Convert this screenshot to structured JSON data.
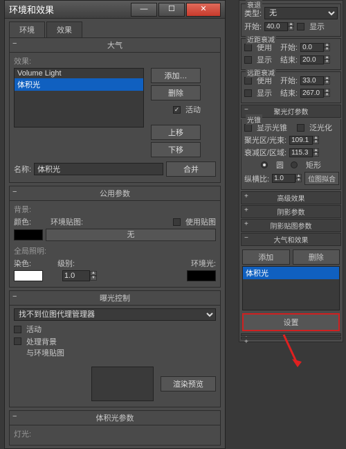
{
  "dialog": {
    "title": "环境和效果",
    "tabs": {
      "env": "环境",
      "fx": "效果"
    },
    "atmosphere": {
      "header": "大气",
      "list": [
        "Volume Light",
        "体积光"
      ],
      "selected_index": 1,
      "buttons": {
        "add": "添加…",
        "del": "删除",
        "up": "上移",
        "down": "下移",
        "merge": "合并"
      },
      "active_cb": "活动",
      "name_label": "名称:",
      "name_value": "体积光"
    },
    "common": {
      "header": "公用参数",
      "bg_label": "背景:",
      "color_label": "颜色:",
      "envmap_label": "环境贴图:",
      "usemap_label": "使用贴图",
      "map_none": "无",
      "global_label": "全局照明:",
      "tint_label": "染色:",
      "level_label": "级别:",
      "level_value": "1.0",
      "amb_label": "环境光:"
    },
    "exposure": {
      "header": "曝光控制",
      "select": "找不到位图代理管理器",
      "active": "活动",
      "process": "处理背景\n与环境贴图",
      "preview": "渲染预览"
    },
    "volume": {
      "header": "体积光参数",
      "lights": "灯光:"
    }
  },
  "right": {
    "decay": "衰退",
    "type_label": "类型:",
    "type_value": "无",
    "start_label": "开始:",
    "start_value": "40.0",
    "show_label": "显示",
    "near": {
      "title": "近距衰减",
      "use": "使用",
      "start": "开始:",
      "start_v": "0.0",
      "show": "显示",
      "end": "结束:",
      "end_v": "20.0"
    },
    "far": {
      "title": "远距衰减",
      "use": "使用",
      "start": "开始:",
      "start_v": "33.0",
      "show": "显示",
      "end": "结束:",
      "end_v": "267.0"
    },
    "spot": {
      "header": "聚光灯参数",
      "cone": "光锥",
      "showcone": "显示光锥",
      "overshoot": "泛光化",
      "hotspot": "聚光区/光束:",
      "hotspot_v": "109.1",
      "falloff": "衰减区/区域:",
      "falloff_v": "115.3",
      "circle": "圆",
      "rect": "矩形",
      "aspect": "纵横比:",
      "aspect_v": "1.0",
      "fit": "位图拟合"
    },
    "bars": {
      "adv": "高级效果",
      "shadow": "阴影参数",
      "shadowmap": "阴影贴图参数",
      "atmo": "大气和效果"
    },
    "atmo": {
      "add": "添加",
      "del": "删除",
      "list_item": "体积光",
      "setup": "设置"
    }
  }
}
